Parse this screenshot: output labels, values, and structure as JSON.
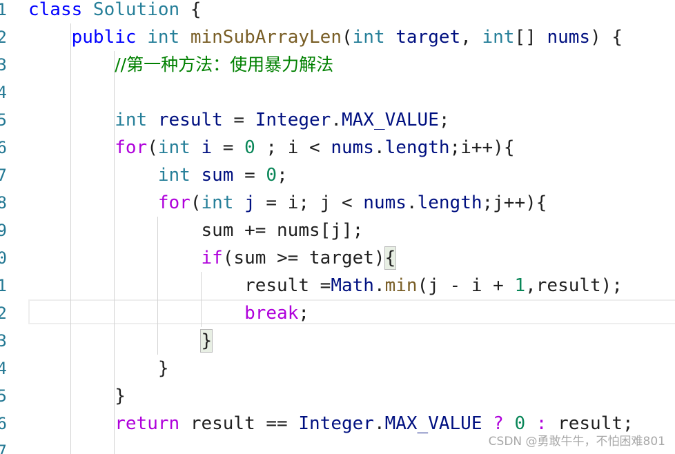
{
  "editor": {
    "line_numbers": [
      "1",
      "2",
      "3",
      "4",
      "5",
      "6",
      "7",
      "8",
      "9",
      "0",
      "1",
      "2",
      "3",
      "4",
      "5",
      "6",
      "7"
    ],
    "lines": [
      [
        {
          "t": "class ",
          "c": "kw"
        },
        {
          "t": "Solution ",
          "c": "ty"
        },
        {
          "t": "{",
          "c": "plain"
        }
      ],
      [
        {
          "t": "    ",
          "c": "plain"
        },
        {
          "t": "public ",
          "c": "kw"
        },
        {
          "t": "int ",
          "c": "ty"
        },
        {
          "t": "minSubArrayLen",
          "c": "fn"
        },
        {
          "t": "(",
          "c": "plain"
        },
        {
          "t": "int ",
          "c": "ty"
        },
        {
          "t": "target",
          "c": "var"
        },
        {
          "t": ", ",
          "c": "plain"
        },
        {
          "t": "int",
          "c": "ty"
        },
        {
          "t": "[] ",
          "c": "plain"
        },
        {
          "t": "nums",
          "c": "var"
        },
        {
          "t": ") {",
          "c": "plain"
        }
      ],
      [
        {
          "t": "        ",
          "c": "plain"
        },
        {
          "t": "//第一种方法：使用暴力解法",
          "c": "cmt"
        }
      ],
      [],
      [
        {
          "t": "        ",
          "c": "plain"
        },
        {
          "t": "int ",
          "c": "ty"
        },
        {
          "t": "result",
          "c": "var"
        },
        {
          "t": " = ",
          "c": "plain"
        },
        {
          "t": "Integer",
          "c": "var"
        },
        {
          "t": ".",
          "c": "plain"
        },
        {
          "t": "MAX_VALUE",
          "c": "var"
        },
        {
          "t": ";",
          "c": "plain"
        }
      ],
      [
        {
          "t": "        ",
          "c": "plain"
        },
        {
          "t": "for",
          "c": "kw2"
        },
        {
          "t": "(",
          "c": "plain"
        },
        {
          "t": "int ",
          "c": "ty"
        },
        {
          "t": "i",
          "c": "var"
        },
        {
          "t": " = ",
          "c": "plain"
        },
        {
          "t": "0",
          "c": "num"
        },
        {
          "t": " ; i < ",
          "c": "plain"
        },
        {
          "t": "nums",
          "c": "var"
        },
        {
          "t": ".",
          "c": "plain"
        },
        {
          "t": "length",
          "c": "var"
        },
        {
          "t": ";i++){",
          "c": "plain"
        }
      ],
      [
        {
          "t": "            ",
          "c": "plain"
        },
        {
          "t": "int ",
          "c": "ty"
        },
        {
          "t": "sum",
          "c": "var"
        },
        {
          "t": " = ",
          "c": "plain"
        },
        {
          "t": "0",
          "c": "num"
        },
        {
          "t": ";",
          "c": "plain"
        }
      ],
      [
        {
          "t": "            ",
          "c": "plain"
        },
        {
          "t": "for",
          "c": "kw2"
        },
        {
          "t": "(",
          "c": "plain"
        },
        {
          "t": "int ",
          "c": "ty"
        },
        {
          "t": "j",
          "c": "var"
        },
        {
          "t": " = i; j < ",
          "c": "plain"
        },
        {
          "t": "nums",
          "c": "var"
        },
        {
          "t": ".",
          "c": "plain"
        },
        {
          "t": "length",
          "c": "var"
        },
        {
          "t": ";j++){",
          "c": "plain"
        }
      ],
      [
        {
          "t": "                ",
          "c": "plain"
        },
        {
          "t": "sum += nums[j];",
          "c": "plain"
        }
      ],
      [
        {
          "t": "                ",
          "c": "plain"
        },
        {
          "t": "if",
          "c": "kw2"
        },
        {
          "t": "(sum >= target)",
          "c": "plain"
        },
        {
          "t": "{",
          "c": "bracket"
        }
      ],
      [
        {
          "t": "                    ",
          "c": "plain"
        },
        {
          "t": "result =",
          "c": "plain"
        },
        {
          "t": "Math",
          "c": "var"
        },
        {
          "t": ".",
          "c": "plain"
        },
        {
          "t": "min",
          "c": "fn"
        },
        {
          "t": "(j - i + ",
          "c": "plain"
        },
        {
          "t": "1",
          "c": "num"
        },
        {
          "t": ",result);",
          "c": "plain"
        }
      ],
      [
        {
          "t": "                    ",
          "c": "plain"
        },
        {
          "t": "break",
          "c": "kw2"
        },
        {
          "t": ";",
          "c": "plain"
        }
      ],
      [
        {
          "t": "                ",
          "c": "plain"
        },
        {
          "t": "}",
          "c": "bracket"
        }
      ],
      [
        {
          "t": "            ",
          "c": "plain"
        },
        {
          "t": "}",
          "c": "plain"
        }
      ],
      [
        {
          "t": "        ",
          "c": "plain"
        },
        {
          "t": "}",
          "c": "plain"
        }
      ],
      [
        {
          "t": "        ",
          "c": "plain"
        },
        {
          "t": "return ",
          "c": "kw2"
        },
        {
          "t": "result == ",
          "c": "plain"
        },
        {
          "t": "Integer",
          "c": "var"
        },
        {
          "t": ".",
          "c": "plain"
        },
        {
          "t": "MAX_VALUE",
          "c": "var"
        },
        {
          "t": " ? ",
          "c": "kw2"
        },
        {
          "t": "0",
          "c": "num"
        },
        {
          "t": " : ",
          "c": "kw2"
        },
        {
          "t": "result;",
          "c": "plain"
        }
      ],
      []
    ]
  },
  "watermark": "CSDN @勇敢牛牛，不怕困难801",
  "colors": {
    "keyword": "#0000ff",
    "control_keyword": "#af00db",
    "type": "#267f99",
    "function": "#795e26",
    "variable": "#001080",
    "number": "#098658",
    "comment": "#008000",
    "line_number": "#237893"
  }
}
